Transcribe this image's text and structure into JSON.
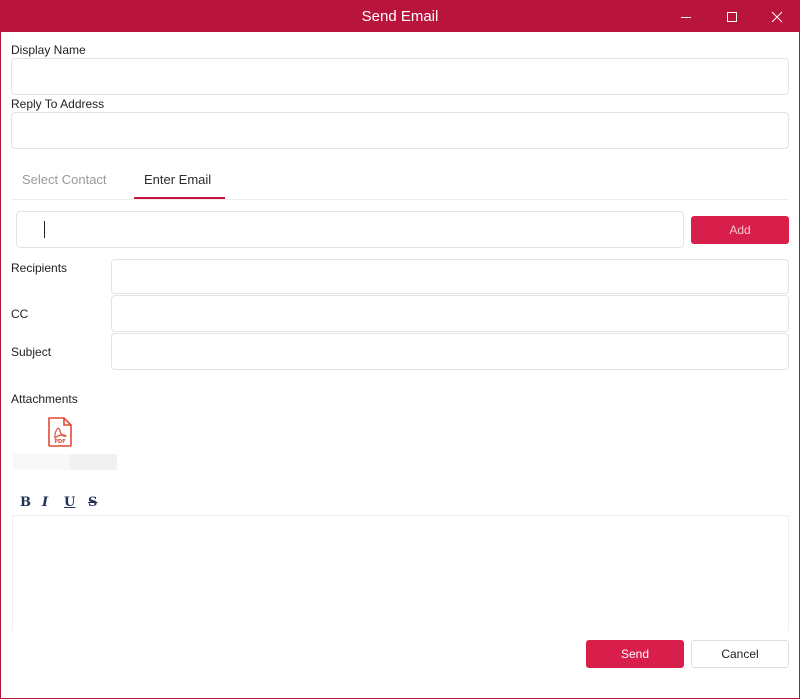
{
  "window": {
    "title": "Send Email"
  },
  "form": {
    "display_name_label": "Display Name",
    "display_name_value": "",
    "reply_to_label": "Reply To Address",
    "reply_to_value": ""
  },
  "tabs": [
    {
      "label": "Select Contact",
      "active": false
    },
    {
      "label": "Enter Email",
      "active": true
    }
  ],
  "email_entry": {
    "value": "",
    "add_label": "Add"
  },
  "recipients": {
    "recipients_label": "Recipients",
    "cc_label": "CC",
    "subject_label": "Subject"
  },
  "attachments": {
    "label": "Attachments",
    "icon_text": "PDF",
    "icon": "pdf-file-icon"
  },
  "editor": {
    "bold_label": "B",
    "italic_label": "I",
    "underline_label": "U",
    "strike_label": "S",
    "body": ""
  },
  "footer": {
    "send_label": "Send",
    "cancel_label": "Cancel"
  },
  "colors": {
    "accent": "#b8143c",
    "button": "#d81e4a"
  }
}
